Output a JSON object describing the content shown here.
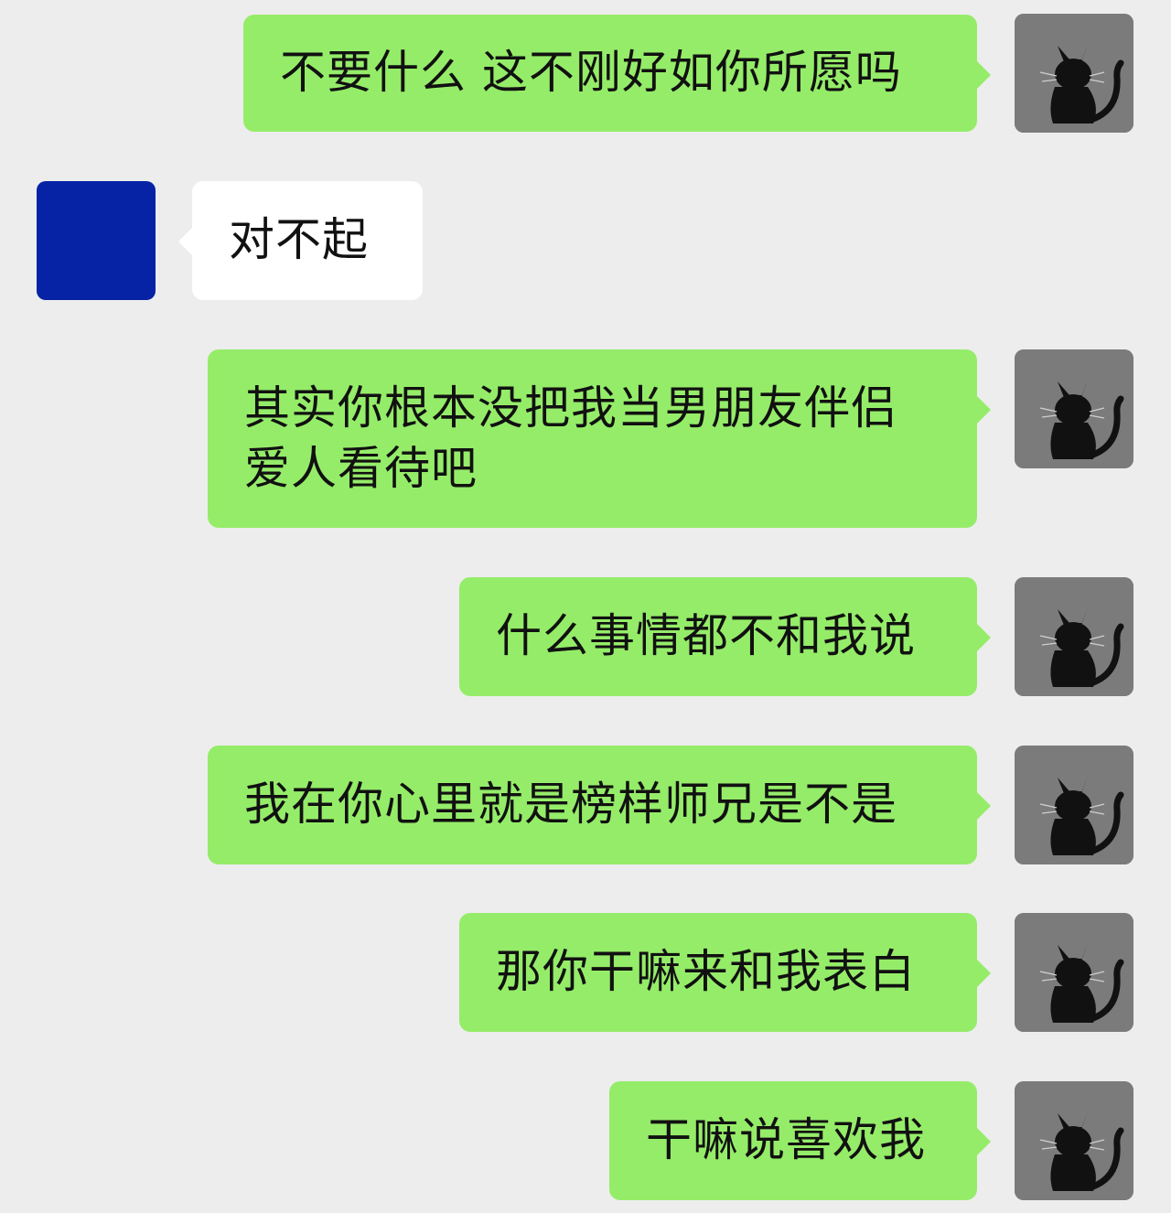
{
  "chat": {
    "messages": [
      {
        "side": "outgoing",
        "avatar": "black-cat-icon",
        "text": "不要什么 这不刚好如你所愿吗"
      },
      {
        "side": "incoming",
        "avatar": "blue-square",
        "text": "对不起"
      },
      {
        "side": "outgoing",
        "avatar": "black-cat-icon",
        "text": "其实你根本没把我当男朋友伴侣\n爱人看待吧"
      },
      {
        "side": "outgoing",
        "avatar": "black-cat-icon",
        "text": "什么事情都不和我说"
      },
      {
        "side": "outgoing",
        "avatar": "black-cat-icon",
        "text": "我在你心里就是榜样师兄是不是"
      },
      {
        "side": "outgoing",
        "avatar": "black-cat-icon",
        "text": "那你干嘛来和我表白"
      },
      {
        "side": "outgoing",
        "avatar": "black-cat-icon",
        "text": "干嘛说喜欢我"
      }
    ]
  },
  "colors": {
    "background": "#ededed",
    "outgoing_bubble": "#95ec69",
    "incoming_bubble": "#ffffff",
    "incoming_avatar": "#0623a6",
    "outgoing_avatar_bg": "#7b7b7b"
  }
}
